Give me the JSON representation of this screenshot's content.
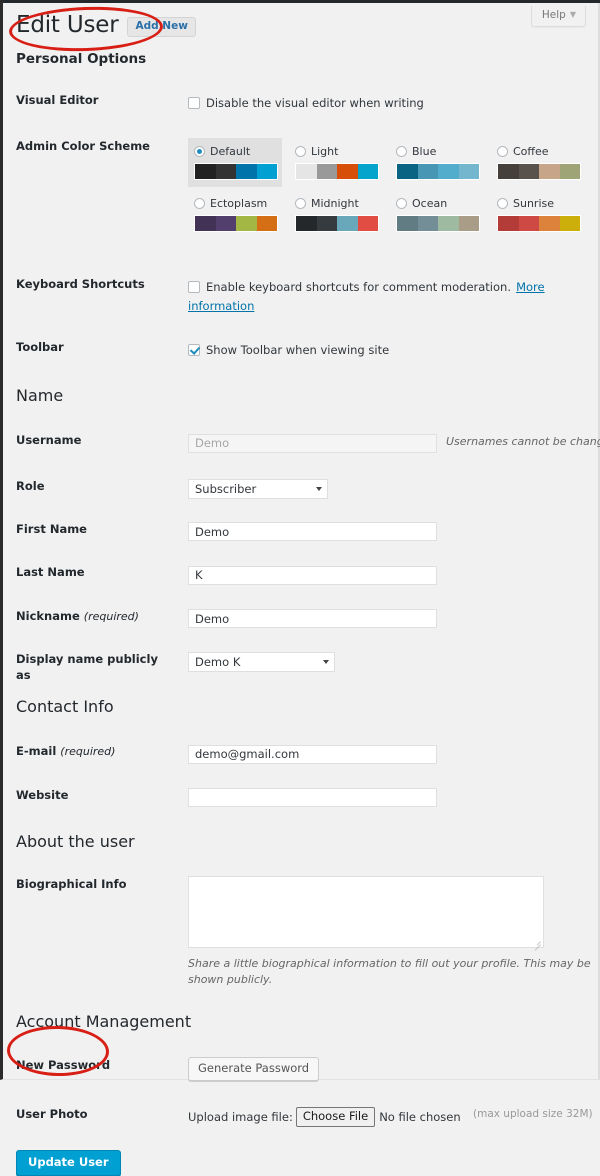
{
  "header": {
    "title": "Edit User",
    "add_new_label": "Add New",
    "help_label": "Help",
    "help_caret": "chevron-down-icon"
  },
  "sections": {
    "personal_options": "Personal Options",
    "name": "Name",
    "contact_info": "Contact Info",
    "about": "About the user",
    "account_management": "Account Management"
  },
  "personal_options": {
    "visual_editor": {
      "label": "Visual Editor",
      "checkbox_label": "Disable the visual editor when writing",
      "checked": false
    },
    "admin_color_scheme": {
      "label": "Admin Color Scheme",
      "selected": "Default",
      "schemes": [
        {
          "name": "Default",
          "selected": true,
          "colors": [
            "#222222",
            "#333333",
            "#0073aa",
            "#00a0d2"
          ]
        },
        {
          "name": "Light",
          "selected": false,
          "colors": [
            "#e5e5e5",
            "#999999",
            "#d64e07",
            "#04a4cc"
          ]
        },
        {
          "name": "Blue",
          "selected": false,
          "colors": [
            "#096484",
            "#4796b3",
            "#52accc",
            "#74b6ce"
          ]
        },
        {
          "name": "Coffee",
          "selected": false,
          "colors": [
            "#46403c",
            "#59524c",
            "#c7a589",
            "#9ea476"
          ]
        },
        {
          "name": "Ectoplasm",
          "selected": false,
          "colors": [
            "#413256",
            "#523f6d",
            "#a3b745",
            "#d46f15"
          ]
        },
        {
          "name": "Midnight",
          "selected": false,
          "colors": [
            "#25282b",
            "#363b3f",
            "#69a8bb",
            "#e14d43"
          ]
        },
        {
          "name": "Ocean",
          "selected": false,
          "colors": [
            "#627c83",
            "#738e96",
            "#9ebaa0",
            "#aa9d88"
          ]
        },
        {
          "name": "Sunrise",
          "selected": false,
          "colors": [
            "#b43c38",
            "#cf4944",
            "#dd823b",
            "#ccaf0b"
          ]
        }
      ]
    },
    "keyboard_shortcuts": {
      "label": "Keyboard Shortcuts",
      "checkbox_label": "Enable keyboard shortcuts for comment moderation.",
      "link_label": "More information",
      "checked": false
    },
    "toolbar": {
      "label": "Toolbar",
      "checkbox_label": "Show Toolbar when viewing site",
      "checked": true
    }
  },
  "name_section": {
    "username": {
      "label": "Username",
      "value": "Demo",
      "hint": "Usernames cannot be changed."
    },
    "role": {
      "label": "Role",
      "value": "Subscriber"
    },
    "first_name": {
      "label": "First Name",
      "value": "Demo"
    },
    "last_name": {
      "label": "Last Name",
      "value": "K"
    },
    "nickname": {
      "label": "Nickname",
      "required_note": "(required)",
      "value": "Demo"
    },
    "display_name": {
      "label": "Display name publicly as",
      "value": "Demo K"
    }
  },
  "contact_info": {
    "email": {
      "label": "E-mail",
      "required_note": "(required)",
      "value": "demo@gmail.com"
    },
    "website": {
      "label": "Website",
      "value": ""
    }
  },
  "about_user": {
    "bio": {
      "label": "Biographical Info",
      "value": "",
      "hint": "Share a little biographical information to fill out your profile. This may be shown publicly."
    }
  },
  "account_management": {
    "new_password": {
      "label": "New Password",
      "button_label": "Generate Password"
    },
    "user_photo": {
      "label": "User Photo",
      "upload_label": "Upload image file:",
      "choose_file_label": "Choose File",
      "no_file_label": "No file chosen",
      "max_size_note": "(max upload size 32M)"
    }
  },
  "footer": {
    "update_label": "Update User"
  },
  "colors": {
    "accent": "#00a0d2",
    "link": "#0073aa",
    "annotation": "#d81f16",
    "page_bg": "#f1f1f1"
  }
}
